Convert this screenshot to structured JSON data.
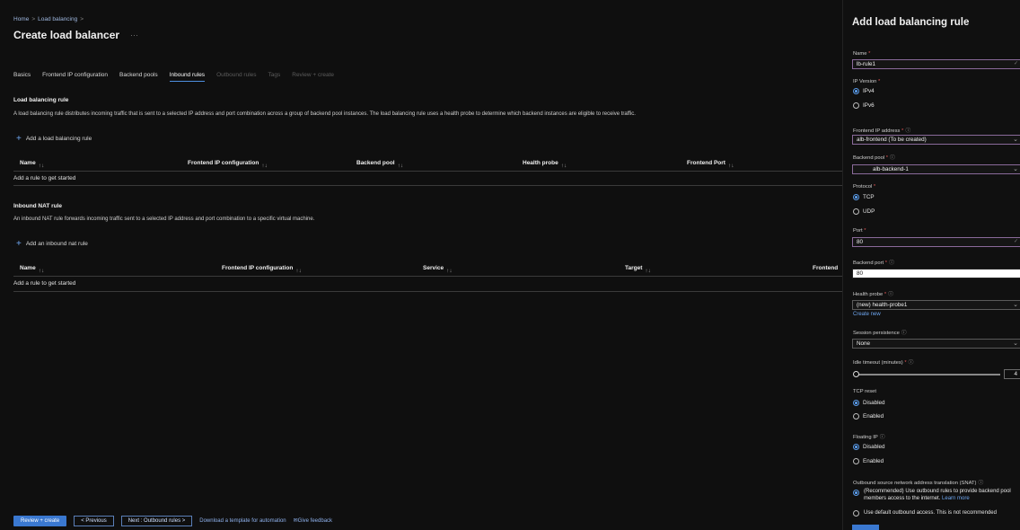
{
  "breadcrumb": {
    "home": "Home",
    "sep": ">",
    "item": "Load balancing",
    "trail": ">"
  },
  "page": {
    "title": "Create load balancer",
    "more": "···"
  },
  "tabs": [
    {
      "label": "Basics",
      "state": "normal"
    },
    {
      "label": "Frontend IP configuration",
      "state": "normal"
    },
    {
      "label": "Backend pools",
      "state": "normal"
    },
    {
      "label": "Inbound rules",
      "state": "active"
    },
    {
      "label": "Outbound rules",
      "state": "disabled"
    },
    {
      "label": "Tags",
      "state": "disabled"
    },
    {
      "label": "Review + create",
      "state": "disabled"
    }
  ],
  "lb_rule": {
    "title": "Load balancing rule",
    "description": "A load balancing rule distributes incoming traffic that is sent to a selected IP address and port combination across a group of backend pool instances. The load balancing rule uses a health probe to determine which backend instances are eligible to receive traffic.",
    "add_label": "Add a load balancing rule",
    "columns": [
      "Name",
      "Frontend IP configuration",
      "Backend pool",
      "Health probe",
      "Frontend Port"
    ],
    "empty": "Add a rule to get started"
  },
  "nat_rule": {
    "title": "Inbound NAT rule",
    "description": "An inbound NAT rule forwards incoming traffic sent to a selected IP address and port combination to a specific virtual machine.",
    "add_label": "Add an inbound nat rule",
    "columns": [
      "Name",
      "Frontend IP configuration",
      "Service",
      "Target",
      "Frontend"
    ],
    "empty": "Add a rule to get started"
  },
  "sort_glyph": "↑↓",
  "footer": {
    "review": "Review + create",
    "previous": "< Previous",
    "next": "Next : Outbound rules >",
    "download": "Download a template for automation",
    "feedback": "Give feedback"
  },
  "panel": {
    "title": "Add load balancing rule",
    "name_label": "Name",
    "name_value": "lb-rule1",
    "ipver_label": "IP Version",
    "ipv4": "IPv4",
    "ipv6": "IPv6",
    "frontend_label": "Frontend IP address",
    "frontend_value": "alb-frontend (To be created)",
    "backend_label": "Backend pool",
    "backend_value": "alb-backend-1",
    "protocol_label": "Protocol",
    "tcp": "TCP",
    "udp": "UDP",
    "port_label": "Port",
    "port_value": "80",
    "bport_label": "Backend port",
    "bport_value": "80",
    "probe_label": "Health probe",
    "probe_value": "(new) health-probe1",
    "create_new": "Create new",
    "session_label": "Session persistence",
    "session_value": "None",
    "idle_label": "Idle timeout (minutes)",
    "idle_value": "4",
    "tcpreset_label": "TCP reset",
    "disabled": "Disabled",
    "enabled": "Enabled",
    "floating_label": "Floating IP",
    "snat_label": "Outbound source network address translation (SNAT)",
    "snat_opt1": "(Recommended) Use outbound rules to provide backend pool members access to the internet.",
    "learn_more": "Learn more",
    "snat_opt2": "Use default outbound access. This is not recommended"
  },
  "colors": {
    "accent": "#3a78d0",
    "link": "#6ea6f0",
    "background": "#0f0f0f"
  }
}
